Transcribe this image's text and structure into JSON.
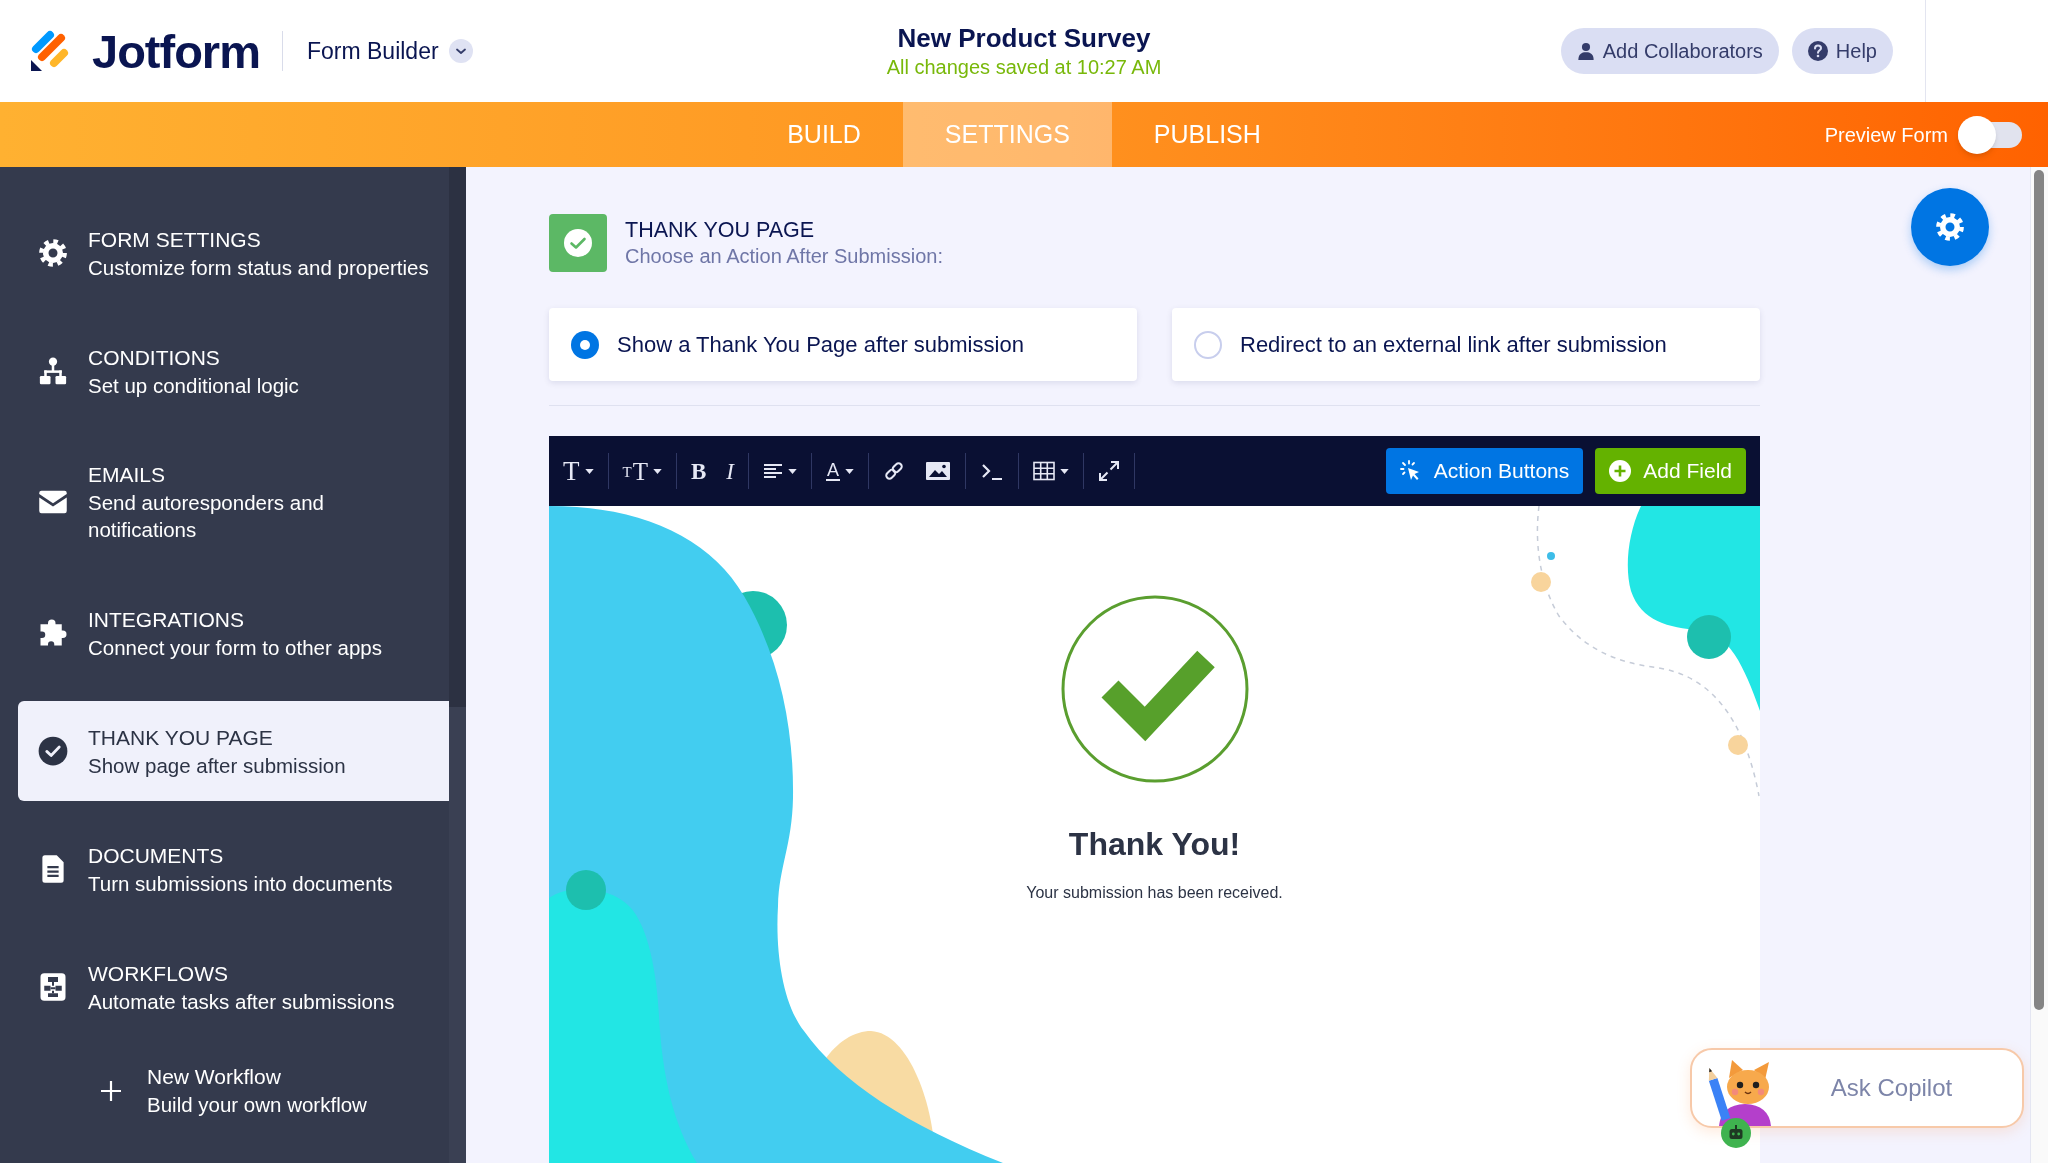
{
  "header": {
    "logo": "Jotform",
    "app_menu": "Form Builder",
    "form_title": "New Product Survey",
    "save_status": "All changes saved at 10:27 AM",
    "buttons": [
      {
        "label": "Add Collaborators",
        "kind": "collaborators"
      },
      {
        "label": "Help",
        "kind": "help"
      }
    ]
  },
  "nav": {
    "tabs": [
      {
        "label": "BUILD",
        "selected": false
      },
      {
        "label": "SETTINGS",
        "selected": true
      },
      {
        "label": "PUBLISH",
        "selected": false
      }
    ],
    "preview": {
      "label": "Preview Form",
      "on": false
    }
  },
  "sidebar": {
    "items": [
      {
        "kind": "section",
        "title": "FORM SETTINGS",
        "subtitle": "Customize form status and properties",
        "selected": false
      },
      {
        "kind": "section",
        "title": "CONDITIONS",
        "subtitle": "Set up conditional logic",
        "selected": false
      },
      {
        "kind": "section",
        "title": "EMAILS",
        "subtitle": "Send autoresponders and notifications",
        "selected": false
      },
      {
        "kind": "section",
        "title": "INTEGRATIONS",
        "subtitle": "Connect your form to other apps",
        "selected": false
      },
      {
        "kind": "section",
        "title": "THANK YOU PAGE",
        "subtitle": "Show page after submission",
        "selected": true
      },
      {
        "kind": "section",
        "title": "DOCUMENTS",
        "subtitle": "Turn submissions into documents",
        "selected": false
      },
      {
        "kind": "section",
        "title": "WORKFLOWS",
        "subtitle": "Automate tasks after submissions",
        "selected": false
      },
      {
        "kind": "action",
        "title": "New Workflow",
        "subtitle": "Build your own workflow",
        "selected": false
      }
    ]
  },
  "thank_you": {
    "title": "THANK YOU PAGE",
    "subtitle": "Choose an Action After Submission:",
    "options": [
      {
        "label": "Show a Thank You Page after submission",
        "selected": true
      },
      {
        "label": "Redirect to an external link after submission",
        "selected": false
      }
    ]
  },
  "editor": {
    "tool_groups": [
      [
        {
          "kind": "font",
          "glyph": "T",
          "dropdown": true
        }
      ],
      [
        {
          "kind": "size",
          "glyphs": [
            "T",
            "T"
          ],
          "dropdown": true
        }
      ],
      [
        {
          "kind": "bold",
          "glyph": "B",
          "dropdown": false
        },
        {
          "kind": "italic",
          "glyph": "I",
          "dropdown": false
        }
      ],
      [
        {
          "kind": "align",
          "dropdown": true
        }
      ],
      [
        {
          "kind": "color",
          "glyph": "A",
          "dropdown": true
        }
      ],
      [
        {
          "kind": "link",
          "dropdown": false
        },
        {
          "kind": "image",
          "dropdown": false
        }
      ],
      [
        {
          "kind": "terminal",
          "dropdown": false
        }
      ],
      [
        {
          "kind": "table",
          "dropdown": true
        }
      ],
      [
        {
          "kind": "expand",
          "dropdown": false
        }
      ]
    ],
    "buttons": [
      {
        "label": "Action Buttons",
        "kind": "action"
      },
      {
        "label": "Add Field",
        "kind": "add"
      }
    ],
    "page": {
      "heading": "Thank You!",
      "message": "Your submission has been received."
    }
  },
  "copilot": {
    "label": "Ask Copilot"
  }
}
